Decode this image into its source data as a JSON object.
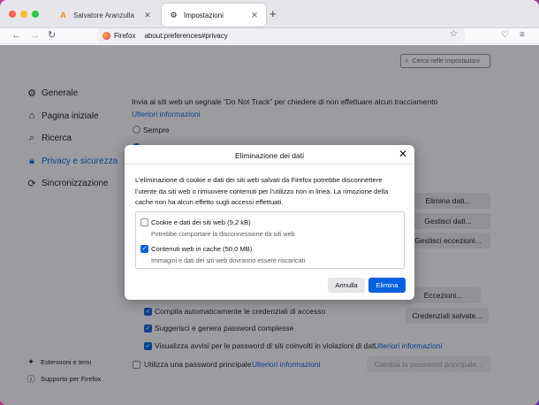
{
  "tabs": [
    {
      "title": "Salvatore Aranzulla",
      "active": false,
      "icon": "aranzulla-logo-icon"
    },
    {
      "title": "Impostazioni",
      "active": true,
      "icon": "gear-icon"
    }
  ],
  "url_bar": {
    "identity_label": "Firefox",
    "url": "about:preferences#privacy"
  },
  "search": {
    "placeholder": "Cerca nelle impostazioni"
  },
  "sidebar": {
    "items": [
      {
        "label": "Generale",
        "icon": "gear-icon"
      },
      {
        "label": "Pagina iniziale",
        "icon": "home-icon"
      },
      {
        "label": "Ricerca",
        "icon": "search-icon"
      },
      {
        "label": "Privacy e sicurezza",
        "icon": "lock-icon",
        "active": true
      },
      {
        "label": "Sincronizzazione",
        "icon": "sync-icon"
      }
    ],
    "bottom": [
      {
        "label": "Estensioni e temi",
        "icon": "puzzle-icon"
      },
      {
        "label": "Supporto per Firefox",
        "icon": "help-icon"
      }
    ]
  },
  "main": {
    "dnt_text": "Invia ai siti web un segnale “Do Not Track” per chiedere di non effettuare alcun tracciamento",
    "dnt_link": "Ulteriori informazioni",
    "radio_always": "Sempre",
    "buttons": {
      "clear_data": "Elimina dati...",
      "manage_data": "Gestisci dati...",
      "manage_exceptions": "Gestisci eccezioni...",
      "exceptions": "Eccezioni...",
      "saved_logins": "Credenziali salvate...",
      "change_master_password": "Cambia la password principale..."
    },
    "autofill_logins": "Compila automaticamente le credenziali di accesso",
    "suggest_passwords": "Suggerisci e genera password complesse",
    "breach_alerts": "Visualizza avvisi per le password di siti coinvolti in violazioni di dati",
    "breach_link": "Ulteriori informazioni",
    "master_password": "Utilizza una password principale",
    "master_link": "Ulteriori informazioni"
  },
  "dialog": {
    "title": "Eliminazione dei dati",
    "description": "L’eliminazione di cookie e dati dei siti web salvati da Firefox potrebbe disconnettere l’utente da siti web o rimuovere contenuti per l’utilizzo non in linea. La rimozione della cache non ha alcun effetto sugli accessi effettuati.",
    "options": [
      {
        "label": "Cookie e dati dei siti web (9,2 kB)",
        "sub": "Potrebbe comportare la disconnessione da siti web",
        "checked": false
      },
      {
        "label": "Contenuti web in cache (50,0 MB)",
        "sub": "Immagini e dati dei siti web dovranno essere riscaricati",
        "checked": true
      }
    ],
    "cancel": "Annulla",
    "confirm": "Elimina"
  },
  "colors": {
    "accent": "#0061e0",
    "overlay": "#1c1b22"
  }
}
